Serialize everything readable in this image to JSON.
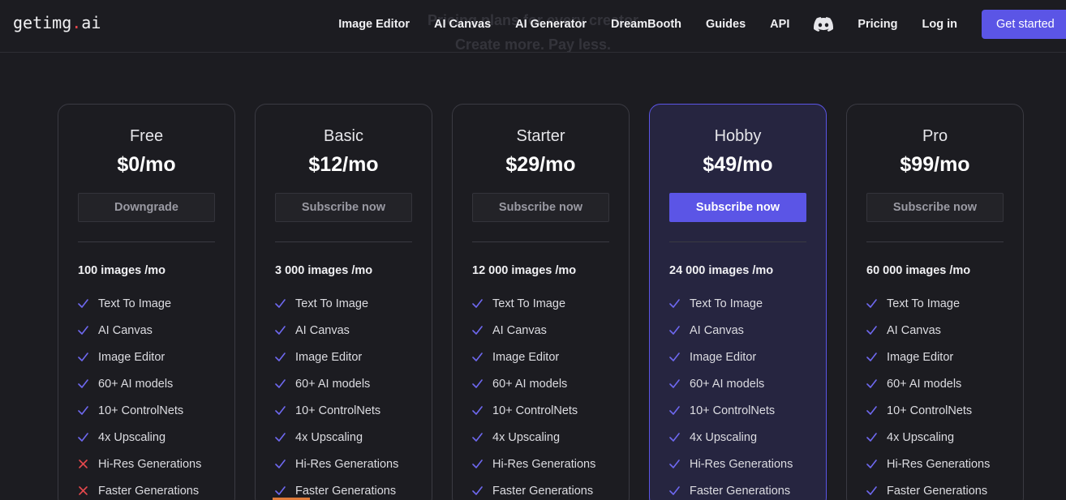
{
  "background_text": {
    "line1": "Pricing plans for every creator",
    "line2": "Create more. Pay less."
  },
  "header": {
    "logo_prefix": "getimg",
    "logo_dot": ".",
    "logo_suffix": "ai",
    "nav": {
      "image_editor": "Image Editor",
      "ai_canvas": "AI Canvas",
      "ai_generator": "AI Generator",
      "dreambooth": "DreamBooth",
      "guides": "Guides",
      "api": "API",
      "discord_icon": "discord-icon",
      "pricing": "Pricing",
      "login": "Log in",
      "get_started": "Get started"
    }
  },
  "colors": {
    "accent": "#5b55e6",
    "check": "#6e68f0",
    "cross": "#e5484d",
    "background": "#1c1c21",
    "featured_card": "#262540"
  },
  "plans": [
    {
      "name": "Free",
      "price": "$0/mo",
      "button": "Downgrade",
      "quota": "100 images /mo",
      "features": [
        {
          "label": "Text To Image",
          "included": true
        },
        {
          "label": "AI Canvas",
          "included": true
        },
        {
          "label": "Image Editor",
          "included": true
        },
        {
          "label": "60+ AI models",
          "included": true
        },
        {
          "label": "10+ ControlNets",
          "included": true
        },
        {
          "label": "4x Upscaling",
          "included": true
        },
        {
          "label": "Hi-Res Generations",
          "included": false
        },
        {
          "label": "Faster Generations",
          "included": false
        }
      ]
    },
    {
      "name": "Basic",
      "price": "$12/mo",
      "button": "Subscribe now",
      "quota": "3 000 images /mo",
      "features": [
        {
          "label": "Text To Image",
          "included": true
        },
        {
          "label": "AI Canvas",
          "included": true
        },
        {
          "label": "Image Editor",
          "included": true
        },
        {
          "label": "60+ AI models",
          "included": true
        },
        {
          "label": "10+ ControlNets",
          "included": true
        },
        {
          "label": "4x Upscaling",
          "included": true
        },
        {
          "label": "Hi-Res Generations",
          "included": true
        },
        {
          "label": "Faster Generations",
          "included": true
        }
      ]
    },
    {
      "name": "Starter",
      "price": "$29/mo",
      "button": "Subscribe now",
      "quota": "12 000 images /mo",
      "features": [
        {
          "label": "Text To Image",
          "included": true
        },
        {
          "label": "AI Canvas",
          "included": true
        },
        {
          "label": "Image Editor",
          "included": true
        },
        {
          "label": "60+ AI models",
          "included": true
        },
        {
          "label": "10+ ControlNets",
          "included": true
        },
        {
          "label": "4x Upscaling",
          "included": true
        },
        {
          "label": "Hi-Res Generations",
          "included": true
        },
        {
          "label": "Faster Generations",
          "included": true
        }
      ]
    },
    {
      "name": "Hobby",
      "price": "$49/mo",
      "button": "Subscribe now",
      "quota": "24 000 images /mo",
      "featured": true,
      "features": [
        {
          "label": "Text To Image",
          "included": true
        },
        {
          "label": "AI Canvas",
          "included": true
        },
        {
          "label": "Image Editor",
          "included": true
        },
        {
          "label": "60+ AI models",
          "included": true
        },
        {
          "label": "10+ ControlNets",
          "included": true
        },
        {
          "label": "4x Upscaling",
          "included": true
        },
        {
          "label": "Hi-Res Generations",
          "included": true
        },
        {
          "label": "Faster Generations",
          "included": true
        }
      ]
    },
    {
      "name": "Pro",
      "price": "$99/mo",
      "button": "Subscribe now",
      "quota": "60 000 images /mo",
      "features": [
        {
          "label": "Text To Image",
          "included": true
        },
        {
          "label": "AI Canvas",
          "included": true
        },
        {
          "label": "Image Editor",
          "included": true
        },
        {
          "label": "60+ AI models",
          "included": true
        },
        {
          "label": "10+ ControlNets",
          "included": true
        },
        {
          "label": "4x Upscaling",
          "included": true
        },
        {
          "label": "Hi-Res Generations",
          "included": true
        },
        {
          "label": "Faster Generations",
          "included": true
        }
      ]
    }
  ]
}
